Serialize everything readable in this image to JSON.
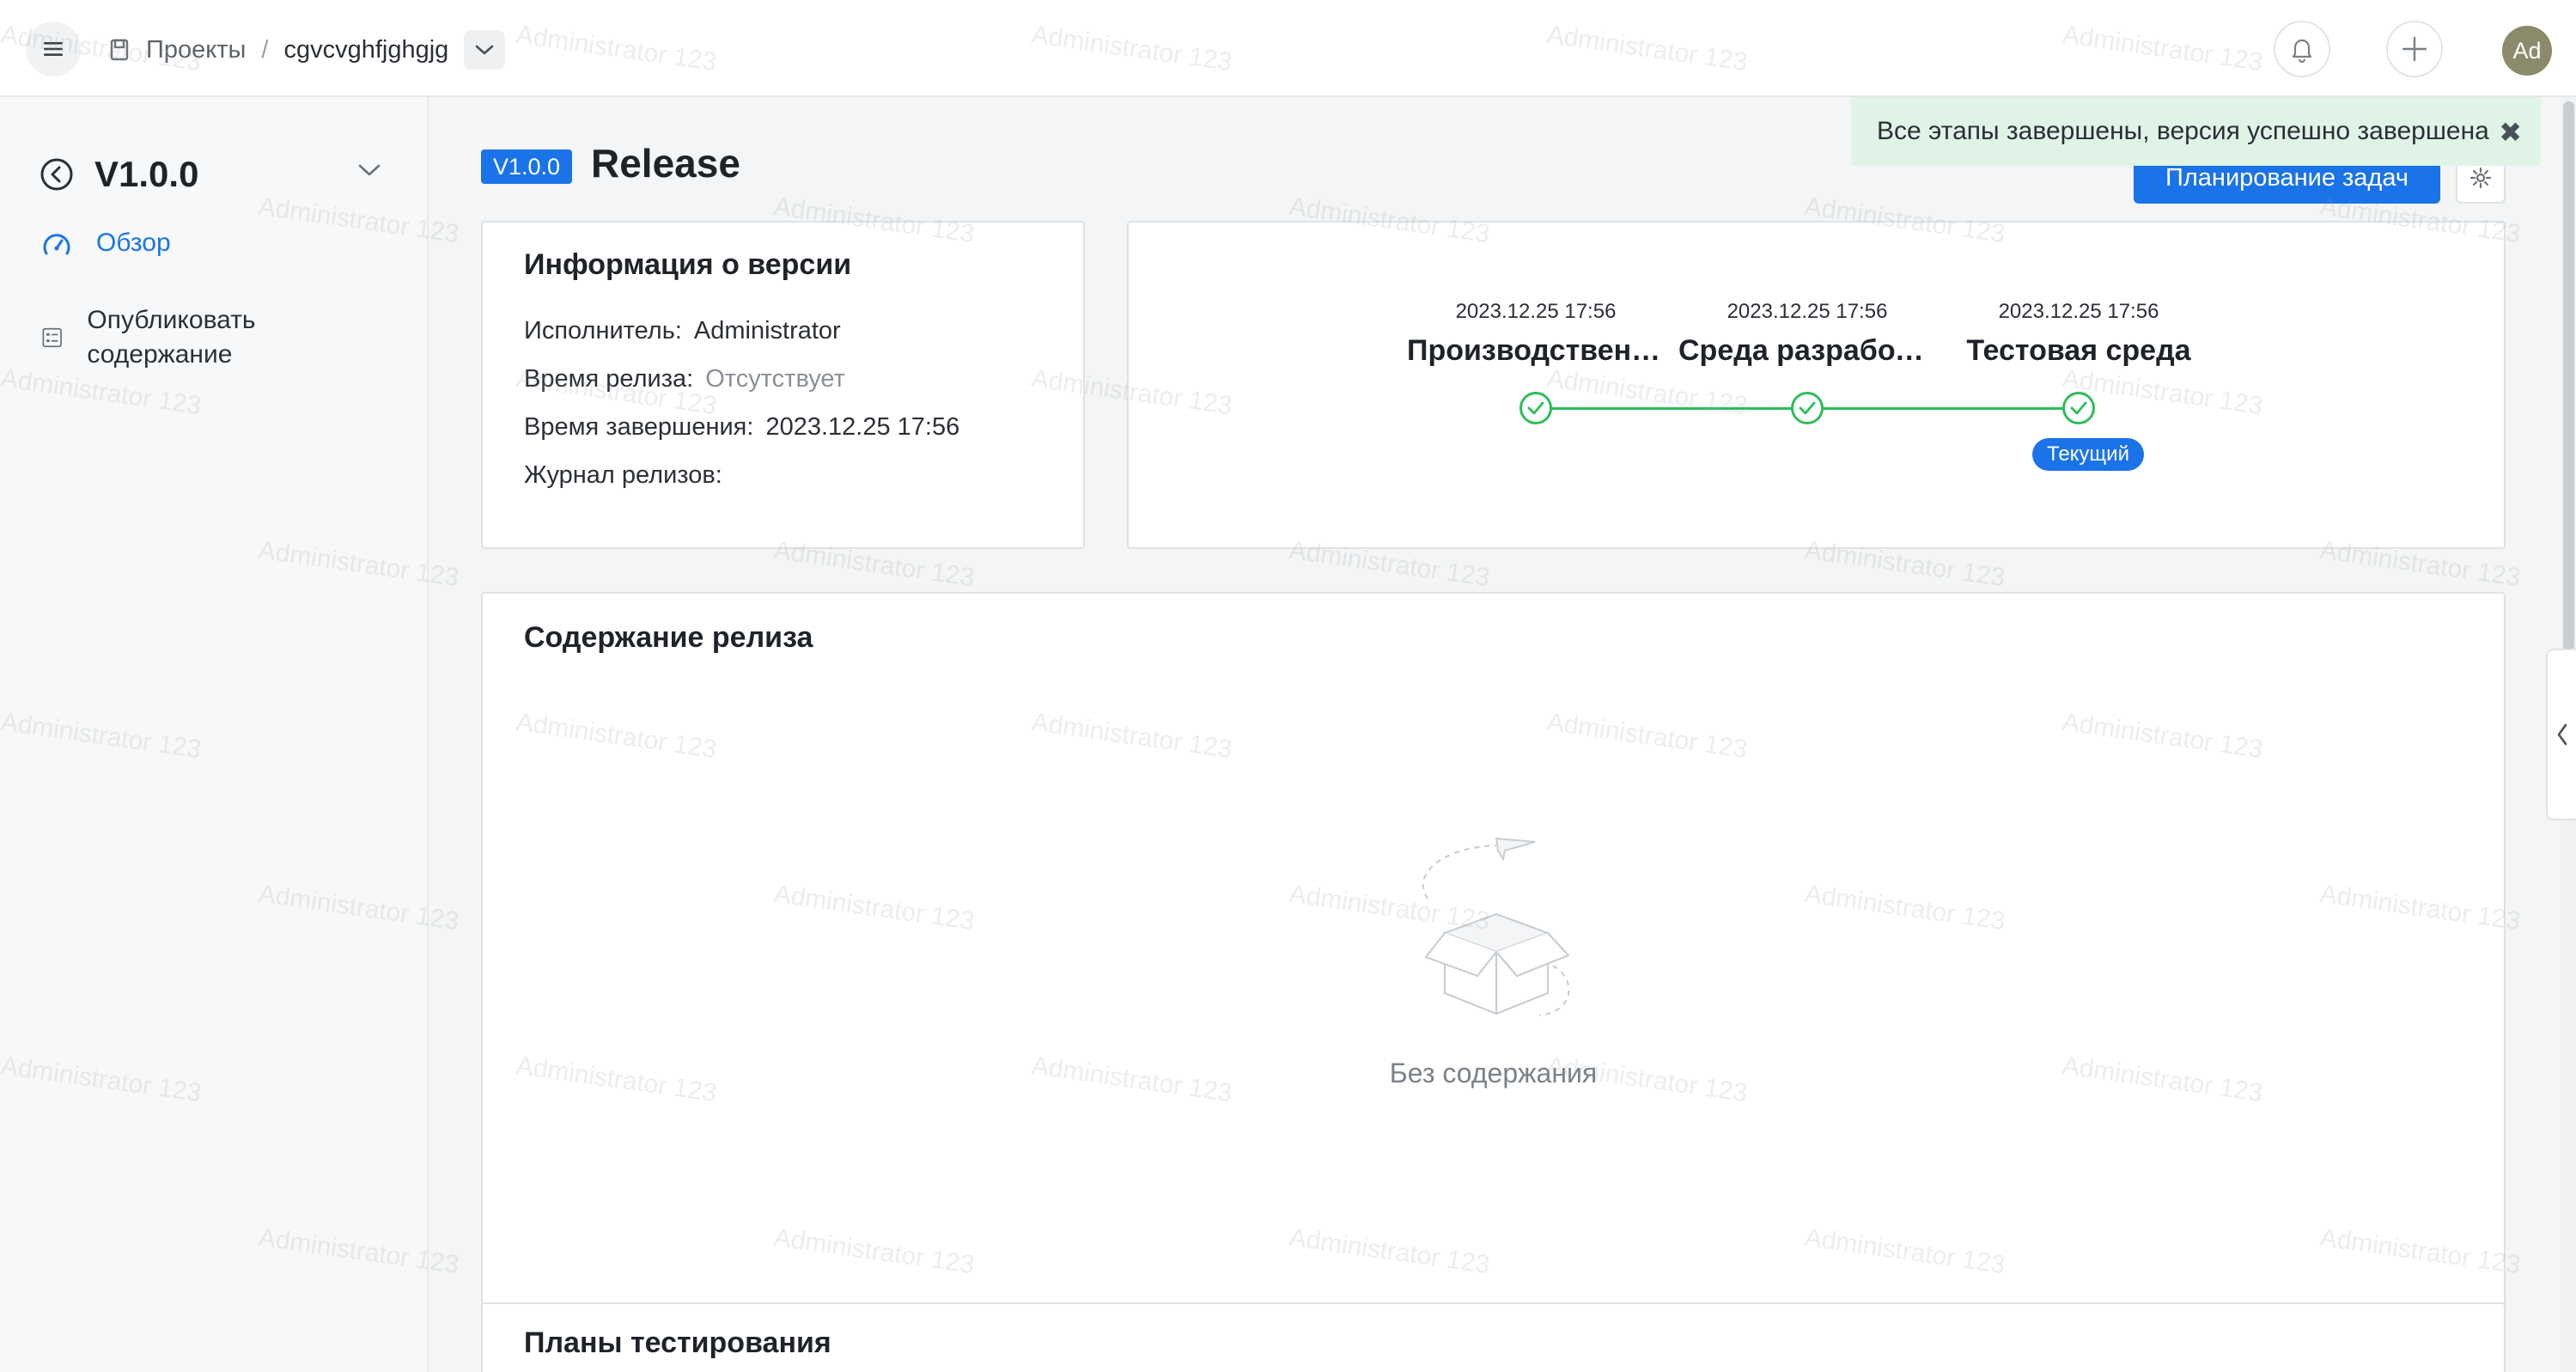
{
  "header": {
    "breadcrumb_root": "Проекты",
    "breadcrumb_sep": "/",
    "project_name": "cgvcvghfjghgjg",
    "avatar_initials": "Ad",
    "icons": [
      "menu-icon",
      "project-icon",
      "chevron-down-icon",
      "bell-icon",
      "plus-icon"
    ]
  },
  "sidebar": {
    "version": "V1.0.0",
    "items": [
      {
        "label": "Обзор",
        "icon": "gauge-icon",
        "active": true
      },
      {
        "label": "Опубликовать содержание",
        "icon": "list-icon",
        "active": false
      }
    ]
  },
  "main": {
    "version_badge": "V1.0.0",
    "title": "Release",
    "plan_button": "Планирование задач",
    "info": {
      "title": "Информация о версии",
      "executor_label": "Исполнитель:",
      "executor_value": "Administrator",
      "release_time_label": "Время релиза:",
      "release_time_value": "Отсутствует",
      "finish_time_label": "Время завершения:",
      "finish_time_value": "2023.12.25 17:56",
      "log_label": "Журнал релизов:"
    },
    "stages": [
      {
        "date": "2023.12.25 17:56",
        "name": "Производственная среда"
      },
      {
        "date": "2023.12.25 17:56",
        "name": "Среда разработки"
      },
      {
        "date": "2023.12.25 17:56",
        "name": "Тестовая среда"
      }
    ],
    "current_tag": "Текущий",
    "content": {
      "title": "Содержание релиза",
      "empty_text": "Без содержания"
    },
    "test_plans": {
      "title": "Планы тестирования"
    }
  },
  "toast": {
    "message": "Все этапы завершены, версия успешно завершена",
    "close": "✖"
  },
  "watermark": "Administrator 123",
  "colors": {
    "accent": "#1a73e8",
    "success": "#2bbd5a",
    "toast_bg": "#dff3e6"
  }
}
